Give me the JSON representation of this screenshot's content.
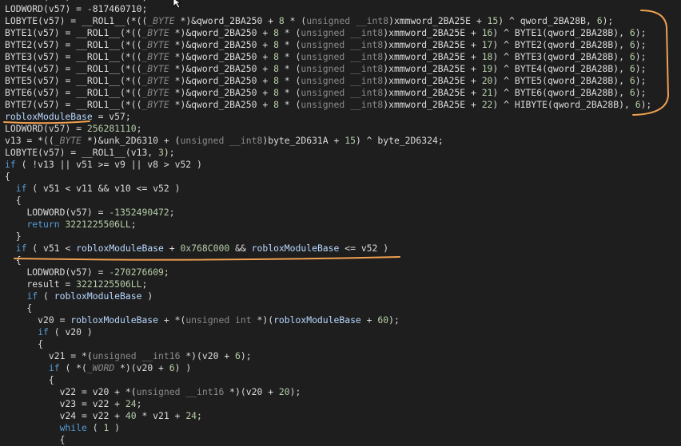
{
  "editor": {
    "lines": [
      [
        {
          "t": "LODWORD(v57) = -817460710;",
          "c": "plain"
        }
      ],
      [
        {
          "t": "LODWORD",
          "c": "fn"
        },
        {
          "t": "(v57) = -817460710;",
          "c": "plain"
        }
      ],
      [
        {
          "t": "LOBYTE",
          "c": "fn"
        },
        {
          "t": "(v57) = __ROL1__(*((",
          "c": "plain"
        },
        {
          "t": "_BYTE",
          "c": "type"
        },
        {
          "t": " *)&qword_2BA250 + ",
          "c": "plain"
        },
        {
          "t": "8",
          "c": "num"
        },
        {
          "t": " * (",
          "c": "plain"
        },
        {
          "t": "unsigned __int8",
          "c": "utype"
        },
        {
          "t": ")xmmword_2BA25E + ",
          "c": "plain"
        },
        {
          "t": "15",
          "c": "num"
        },
        {
          "t": ") ^ qword_2BA28B, ",
          "c": "plain"
        },
        {
          "t": "6",
          "c": "num"
        },
        {
          "t": ");",
          "c": "plain"
        }
      ],
      [
        {
          "t": "BYTE1",
          "c": "fn"
        },
        {
          "t": "(v57) = __ROL1__(*((",
          "c": "plain"
        },
        {
          "t": "_BYTE",
          "c": "type"
        },
        {
          "t": " *)&qword_2BA250 + ",
          "c": "plain"
        },
        {
          "t": "8",
          "c": "num"
        },
        {
          "t": " * (",
          "c": "plain"
        },
        {
          "t": "unsigned __int8",
          "c": "utype"
        },
        {
          "t": ")xmmword_2BA25E + ",
          "c": "plain"
        },
        {
          "t": "16",
          "c": "num"
        },
        {
          "t": ") ^ BYTE1(qword_2BA28B), ",
          "c": "plain"
        },
        {
          "t": "6",
          "c": "num"
        },
        {
          "t": ");",
          "c": "plain"
        }
      ],
      [
        {
          "t": "BYTE2",
          "c": "fn"
        },
        {
          "t": "(v57) = __ROL1__(*((",
          "c": "plain"
        },
        {
          "t": "_BYTE",
          "c": "type"
        },
        {
          "t": " *)&qword_2BA250 + ",
          "c": "plain"
        },
        {
          "t": "8",
          "c": "num"
        },
        {
          "t": " * (",
          "c": "plain"
        },
        {
          "t": "unsigned __int8",
          "c": "utype"
        },
        {
          "t": ")xmmword_2BA25E + ",
          "c": "plain"
        },
        {
          "t": "17",
          "c": "num"
        },
        {
          "t": ") ^ BYTE2(qword_2BA28B), ",
          "c": "plain"
        },
        {
          "t": "6",
          "c": "num"
        },
        {
          "t": ");",
          "c": "plain"
        }
      ],
      [
        {
          "t": "BYTE3",
          "c": "fn"
        },
        {
          "t": "(v57) = __ROL1__(*((",
          "c": "plain"
        },
        {
          "t": "_BYTE",
          "c": "type"
        },
        {
          "t": " *)&qword_2BA250 + ",
          "c": "plain"
        },
        {
          "t": "8",
          "c": "num"
        },
        {
          "t": " * (",
          "c": "plain"
        },
        {
          "t": "unsigned __int8",
          "c": "utype"
        },
        {
          "t": ")xmmword_2BA25E + ",
          "c": "plain"
        },
        {
          "t": "18",
          "c": "num"
        },
        {
          "t": ") ^ BYTE3(qword_2BA28B), ",
          "c": "plain"
        },
        {
          "t": "6",
          "c": "num"
        },
        {
          "t": ");",
          "c": "plain"
        }
      ],
      [
        {
          "t": "BYTE4",
          "c": "fn"
        },
        {
          "t": "(v57) = __ROL1__(*((",
          "c": "plain"
        },
        {
          "t": "_BYTE",
          "c": "type"
        },
        {
          "t": " *)&qword_2BA250 + ",
          "c": "plain"
        },
        {
          "t": "8",
          "c": "num"
        },
        {
          "t": " * (",
          "c": "plain"
        },
        {
          "t": "unsigned __int8",
          "c": "utype"
        },
        {
          "t": ")xmmword_2BA25E + ",
          "c": "plain"
        },
        {
          "t": "19",
          "c": "num"
        },
        {
          "t": ") ^ BYTE4(qword_2BA28B), ",
          "c": "plain"
        },
        {
          "t": "6",
          "c": "num"
        },
        {
          "t": ");",
          "c": "plain"
        }
      ],
      [
        {
          "t": "BYTE5",
          "c": "fn"
        },
        {
          "t": "(v57) = __ROL1__(*((",
          "c": "plain"
        },
        {
          "t": "_BYTE",
          "c": "type"
        },
        {
          "t": " *)&qword_2BA250 + ",
          "c": "plain"
        },
        {
          "t": "8",
          "c": "num"
        },
        {
          "t": " * (",
          "c": "plain"
        },
        {
          "t": "unsigned __int8",
          "c": "utype"
        },
        {
          "t": ")xmmword_2BA25E + ",
          "c": "plain"
        },
        {
          "t": "20",
          "c": "num"
        },
        {
          "t": ") ^ BYTE5(qword_2BA28B), ",
          "c": "plain"
        },
        {
          "t": "6",
          "c": "num"
        },
        {
          "t": ");",
          "c": "plain"
        }
      ],
      [
        {
          "t": "BYTE6",
          "c": "fn"
        },
        {
          "t": "(v57) = __ROL1__(*((",
          "c": "plain"
        },
        {
          "t": "_BYTE",
          "c": "type"
        },
        {
          "t": " *)&qword_2BA250 + ",
          "c": "plain"
        },
        {
          "t": "8",
          "c": "num"
        },
        {
          "t": " * (",
          "c": "plain"
        },
        {
          "t": "unsigned __int8",
          "c": "utype"
        },
        {
          "t": ")xmmword_2BA25E + ",
          "c": "plain"
        },
        {
          "t": "21",
          "c": "num"
        },
        {
          "t": ") ^ BYTE6(qword_2BA28B), ",
          "c": "plain"
        },
        {
          "t": "6",
          "c": "num"
        },
        {
          "t": ");",
          "c": "plain"
        }
      ],
      [
        {
          "t": "BYTE7",
          "c": "fn"
        },
        {
          "t": "(v57) = __ROL1__(*((",
          "c": "plain"
        },
        {
          "t": "_BYTE",
          "c": "type"
        },
        {
          "t": " *)&qword_2BA250 + ",
          "c": "plain"
        },
        {
          "t": "8",
          "c": "num"
        },
        {
          "t": " * (",
          "c": "plain"
        },
        {
          "t": "unsigned __int8",
          "c": "utype"
        },
        {
          "t": ")xmmword_2BA25E + ",
          "c": "plain"
        },
        {
          "t": "22",
          "c": "num"
        },
        {
          "t": ") ^ HIBYTE(qword_2BA28B), ",
          "c": "plain"
        },
        {
          "t": "6",
          "c": "num"
        },
        {
          "t": ");",
          "c": "plain"
        }
      ],
      [
        {
          "t": "robloxModuleBase",
          "c": "hl"
        },
        {
          "t": " = v57;",
          "c": "plain"
        }
      ],
      [
        {
          "t": "LODWORD",
          "c": "fn"
        },
        {
          "t": "(v57) = ",
          "c": "plain"
        },
        {
          "t": "256281110",
          "c": "num"
        },
        {
          "t": ";",
          "c": "plain"
        }
      ],
      [
        {
          "t": "v13 = *((",
          "c": "plain"
        },
        {
          "t": "_BYTE",
          "c": "type"
        },
        {
          "t": " *)&unk_2D6310 + (",
          "c": "plain"
        },
        {
          "t": "unsigned __int8",
          "c": "utype"
        },
        {
          "t": ")byte_2D631A + ",
          "c": "plain"
        },
        {
          "t": "15",
          "c": "num"
        },
        {
          "t": ") ^ byte_2D6324;",
          "c": "plain"
        }
      ],
      [
        {
          "t": "LOBYTE",
          "c": "fn"
        },
        {
          "t": "(v57) = __ROL1__(v13, ",
          "c": "plain"
        },
        {
          "t": "3",
          "c": "num"
        },
        {
          "t": ");",
          "c": "plain"
        }
      ],
      [
        {
          "t": "if",
          "c": "kw"
        },
        {
          "t": " ( !v13 || v51 >= v9 || v8 > v52 )",
          "c": "plain"
        }
      ],
      [
        {
          "t": "{",
          "c": "plain"
        }
      ],
      [
        {
          "t": "  ",
          "c": "plain"
        },
        {
          "t": "if",
          "c": "kw"
        },
        {
          "t": " ( v51 < v11 && v10 <= v52 )",
          "c": "plain"
        }
      ],
      [
        {
          "t": "  {",
          "c": "plain"
        }
      ],
      [
        {
          "t": "    ",
          "c": "plain"
        },
        {
          "t": "LODWORD",
          "c": "fn"
        },
        {
          "t": "(v57) = ",
          "c": "plain"
        },
        {
          "t": "-1352490472",
          "c": "num"
        },
        {
          "t": ";",
          "c": "plain"
        }
      ],
      [
        {
          "t": "    ",
          "c": "plain"
        },
        {
          "t": "return",
          "c": "kw"
        },
        {
          "t": " ",
          "c": "plain"
        },
        {
          "t": "3221225506LL",
          "c": "num"
        },
        {
          "t": ";",
          "c": "plain"
        }
      ],
      [
        {
          "t": "  }",
          "c": "plain"
        }
      ],
      [
        {
          "t": "  ",
          "c": "plain"
        },
        {
          "t": "if",
          "c": "kw"
        },
        {
          "t": " ( v51 < ",
          "c": "plain"
        },
        {
          "t": "robloxModuleBase",
          "c": "hl"
        },
        {
          "t": " + ",
          "c": "plain"
        },
        {
          "t": "0x768C000",
          "c": "num"
        },
        {
          "t": " && ",
          "c": "plain"
        },
        {
          "t": "robloxModuleBase",
          "c": "hl"
        },
        {
          "t": " <= v52 )",
          "c": "plain"
        }
      ],
      [
        {
          "t": "  {",
          "c": "plain"
        }
      ],
      [
        {
          "t": "    ",
          "c": "plain"
        },
        {
          "t": "LODWORD",
          "c": "fn"
        },
        {
          "t": "(v57) = ",
          "c": "plain"
        },
        {
          "t": "-270276609",
          "c": "num"
        },
        {
          "t": ";",
          "c": "plain"
        }
      ],
      [
        {
          "t": "    result = ",
          "c": "plain"
        },
        {
          "t": "3221225506LL",
          "c": "num"
        },
        {
          "t": ";",
          "c": "plain"
        }
      ],
      [
        {
          "t": "    ",
          "c": "plain"
        },
        {
          "t": "if",
          "c": "kw"
        },
        {
          "t": " ( ",
          "c": "plain"
        },
        {
          "t": "robloxModuleBase",
          "c": "hl"
        },
        {
          "t": " )",
          "c": "plain"
        }
      ],
      [
        {
          "t": "    {",
          "c": "plain"
        }
      ],
      [
        {
          "t": "      v20 = ",
          "c": "plain"
        },
        {
          "t": "robloxModuleBase",
          "c": "hl"
        },
        {
          "t": " + *(",
          "c": "plain"
        },
        {
          "t": "unsigned int",
          "c": "utype"
        },
        {
          "t": " *)(",
          "c": "plain"
        },
        {
          "t": "robloxModuleBase",
          "c": "hl"
        },
        {
          "t": " + ",
          "c": "plain"
        },
        {
          "t": "60",
          "c": "num"
        },
        {
          "t": ");",
          "c": "plain"
        }
      ],
      [
        {
          "t": "      ",
          "c": "plain"
        },
        {
          "t": "if",
          "c": "kw"
        },
        {
          "t": " ( v20 )",
          "c": "plain"
        }
      ],
      [
        {
          "t": "      {",
          "c": "plain"
        }
      ],
      [
        {
          "t": "        v21 = *(",
          "c": "plain"
        },
        {
          "t": "unsigned __int16",
          "c": "utype"
        },
        {
          "t": " *)(v20 + ",
          "c": "plain"
        },
        {
          "t": "6",
          "c": "num"
        },
        {
          "t": ");",
          "c": "plain"
        }
      ],
      [
        {
          "t": "        ",
          "c": "plain"
        },
        {
          "t": "if",
          "c": "kw"
        },
        {
          "t": " ( *(",
          "c": "plain"
        },
        {
          "t": "_WORD",
          "c": "type"
        },
        {
          "t": " *)(v20 + ",
          "c": "plain"
        },
        {
          "t": "6",
          "c": "num"
        },
        {
          "t": ") )",
          "c": "plain"
        }
      ],
      [
        {
          "t": "        {",
          "c": "plain"
        }
      ],
      [
        {
          "t": "          v22 = v20 + *(",
          "c": "plain"
        },
        {
          "t": "unsigned __int16",
          "c": "utype"
        },
        {
          "t": " *)(v20 + ",
          "c": "plain"
        },
        {
          "t": "20",
          "c": "num"
        },
        {
          "t": ");",
          "c": "plain"
        }
      ],
      [
        {
          "t": "          v23 = v22 + ",
          "c": "plain"
        },
        {
          "t": "24",
          "c": "num"
        },
        {
          "t": ";",
          "c": "plain"
        }
      ],
      [
        {
          "t": "          v24 = v22 + ",
          "c": "plain"
        },
        {
          "t": "40",
          "c": "num"
        },
        {
          "t": " * v21 + ",
          "c": "plain"
        },
        {
          "t": "24",
          "c": "num"
        },
        {
          "t": ";",
          "c": "plain"
        }
      ],
      [
        {
          "t": "          ",
          "c": "plain"
        },
        {
          "t": "while",
          "c": "kw"
        },
        {
          "t": " ( ",
          "c": "plain"
        },
        {
          "t": "1",
          "c": "num"
        },
        {
          "t": " )",
          "c": "plain"
        }
      ],
      [
        {
          "t": "          {",
          "c": "plain"
        }
      ]
    ]
  },
  "colors": {
    "background": "#1e1e1e",
    "annotation": "#f0a050"
  }
}
